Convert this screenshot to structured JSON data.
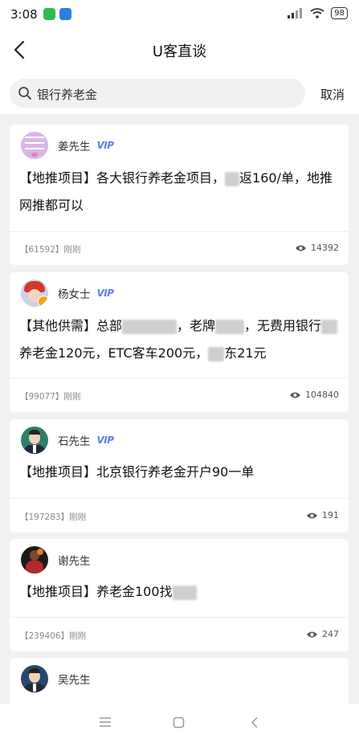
{
  "status_bar": {
    "time": "3:08",
    "battery": "98"
  },
  "header": {
    "title": "U客直谈"
  },
  "search": {
    "value": "银行养老金",
    "cancel_label": "取消"
  },
  "posts": [
    {
      "name": "姜先生",
      "vip": "VIP",
      "text_a": "【地推项目】各大银行养老金项目，",
      "text_b": "返160/单，地推网推都可以",
      "id_time": "【61592】刚刚",
      "views": "14392"
    },
    {
      "name": "杨女士",
      "vip": "VIP",
      "text_a": "【其他供需】总部",
      "text_b": "，老牌",
      "text_c": "，无费用银行",
      "text_d": "养老金120元，ETC客车200元，",
      "text_e": "东21元",
      "id_time": "【99077】刚刚",
      "views": "104840"
    },
    {
      "name": "石先生",
      "vip": "VIP",
      "text": "【地推项目】北京银行养老金开户90一单",
      "id_time": "【197283】刚刚",
      "views": "191"
    },
    {
      "name": "谢先生",
      "text": "【地推项目】养老金100找",
      "id_time": "【239406】刚刚",
      "views": "247"
    },
    {
      "name": "吴先生"
    }
  ]
}
